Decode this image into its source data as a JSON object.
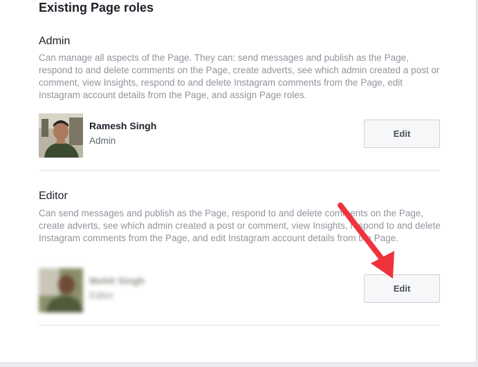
{
  "page_title": "Existing Page roles",
  "sections": [
    {
      "title": "Admin",
      "description": "Can manage all aspects of the Page. They can: send messages and publish as the Page, respond to and delete comments on the Page, create adverts, see which admin created a post or comment, view Insights, respond to and delete Instagram comments from the Page, edit Instagram account details from the Page, and assign Page roles.",
      "user": {
        "name": "Ramesh Singh",
        "role": "Admin"
      },
      "edit_label": "Edit"
    },
    {
      "title": "Editor",
      "description": "Can send messages and publish as the Page, respond to and delete comments on the Page, create adverts, see which admin created a post or comment, view Insights, respond to and delete Instagram comments from the Page, and edit Instagram account details from the Page.",
      "user": {
        "name": "Mohit Singh",
        "role": "Editor"
      },
      "edit_label": "Edit"
    }
  ],
  "colors": {
    "annotation_arrow": "#f0323c",
    "button_bg": "#f6f7f9"
  },
  "icons": {
    "annotation": "arrow-pointer"
  }
}
